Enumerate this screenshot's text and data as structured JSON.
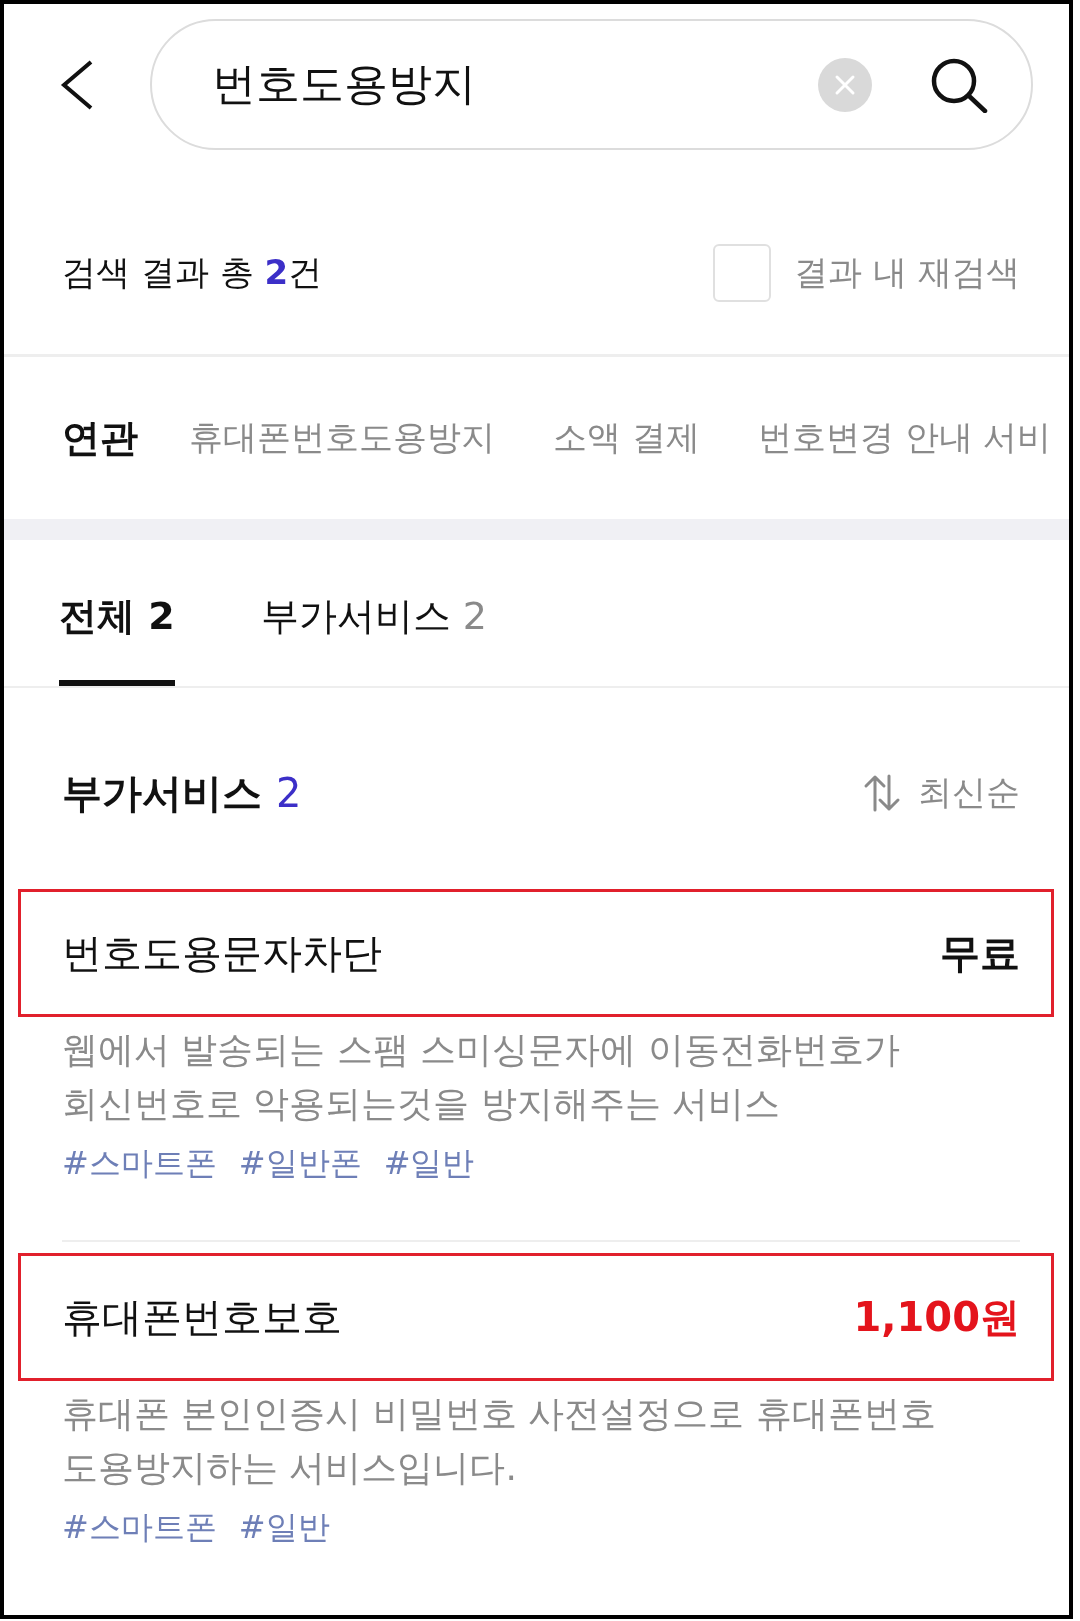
{
  "search": {
    "query": "번호도용방지"
  },
  "result_summary": {
    "label": "검색 결과 총",
    "count": "2",
    "unit": "건"
  },
  "refine": {
    "label": "결과 내 재검색",
    "checked": false
  },
  "related": {
    "label": "연관",
    "keywords": [
      "휴대폰번호도용방지",
      "소액 결제",
      "번호변경 안내 서비"
    ]
  },
  "tabs": [
    {
      "label": "전체",
      "count": "2",
      "selected": true
    },
    {
      "label": "부가서비스",
      "count": "2",
      "selected": false
    }
  ],
  "section": {
    "title": "부가서비스",
    "count": "2",
    "sort_label": "최신순"
  },
  "services": [
    {
      "name": "번호도용문자차단",
      "price": {
        "text": "무료",
        "color": "#111111"
      },
      "highlighted": true,
      "description": "웹에서 발송되는 스팸 스미싱문자에 이동전화번호가 회신번호로 악용되는것을 방지해주는 서비스",
      "tags": [
        "#스마트폰",
        "#일반폰",
        "#일반"
      ]
    },
    {
      "name": "휴대폰번호보호",
      "price": {
        "text": "1,100원",
        "color": "#e4141c"
      },
      "highlighted": true,
      "description": "휴대폰 본인인증시 비밀번호 사전설정으로 휴대폰번호 도용방지하는 서비스입니다.",
      "tags": [
        "#스마트폰",
        "#일반"
      ]
    }
  ]
}
